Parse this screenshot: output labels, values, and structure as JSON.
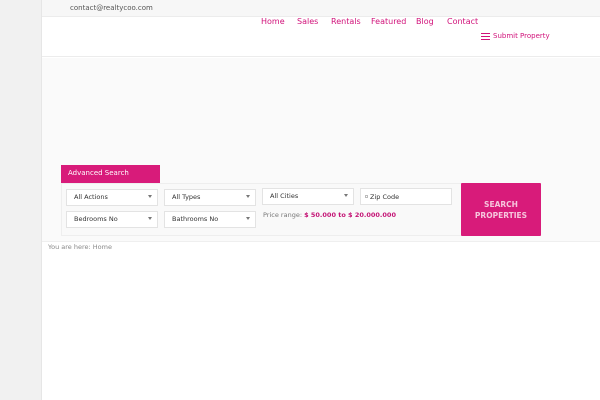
{
  "topbar": {
    "email": "contact@realtycoo.com"
  },
  "nav": {
    "items": [
      {
        "label": "Home"
      },
      {
        "label": "Sales"
      },
      {
        "label": "Rentals"
      },
      {
        "label": "Featured"
      },
      {
        "label": "Blog"
      },
      {
        "label": "Contact"
      }
    ],
    "submit_label": "Submit Property"
  },
  "advanced_search": {
    "tab_label": "Advanced Search",
    "actions": "All Actions",
    "types": "All Types",
    "cities": "All Cities",
    "zip_placeholder": "Zip Code",
    "bedrooms": "Bedrooms No",
    "bathrooms": "Bathrooms No",
    "price_label": "Price range:",
    "price_value": "$ 50.000 to $ 20.000.000",
    "search_line1": "SEARCH",
    "search_line2": "PROPERTIES"
  },
  "breadcrumb": {
    "text": "You are here: Home"
  },
  "colors": {
    "accent": "#d81b7a",
    "nav_text": "#d1127a"
  }
}
